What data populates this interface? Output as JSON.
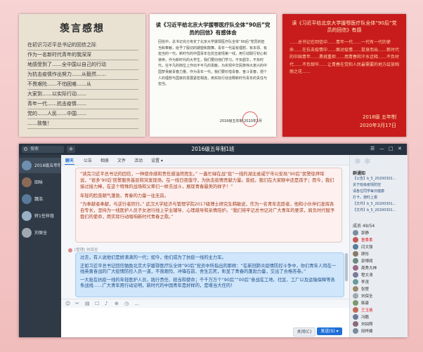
{
  "photos": {
    "p1_title": "羡言感想",
    "p1_lines": [
      "在初识习近平总书记的回信之际",
      "作为一名新时代青年的我深深",
      "地感受到了……全中国以自己的行动",
      "为抗击疫情作出努力……从毅然……",
      "不畏艰险……不怕困难……从",
      "大家到……以实际行动……",
      "青年一代……抗击疫情……",
      "党的……人民……中国……",
      "……致敬！"
    ],
    "p2_title": "读《习近平给北京大学援鄂医疗队全体“90后”党员的回信》有感体会",
    "p2_body": "回信中，总书记充分肯定了北京大学援鄂医疗队全体“90后”党员的担当和奉献，给予了殷切的期望和鼓舞。青年一代是有理想、有本领、有担当的一代，新时代的中国青年在抗击疫情第一线，用行动践行初心和使命。作为新时代的大学生，我们要向他们学习，不负韶华，不负时代，在平凡的岗位上作出不平凡的贡献，为实现中华民族伟大复兴的中国梦贡献青春力量。作为青年一代，我们要珍惜青春、奋斗青春，把个人的理想与国家的发展紧密相连，用实际行动诠释新时代青年的责任与担当。",
    "p2_sign": "2016级五年制 2020年3月",
    "p3_title": "读《习近平给北京大学援鄂医疗队全体“90后”党员的回信》有感",
    "p3_body": "……总书记在回信中……青年一代……一代有一代的使命……在抗击疫情中……面对疫情……挺身而出……新时代的中国青年……勇挑重担……用青春和汗水诠释……不负时代……不负韶华……让青春在党和人民最需要的地方绽放绚丽之花……",
    "p3_sign": "2018级 五年制\n2020年3月17日"
  },
  "window": {
    "search_placeholder": "搜索",
    "plus_label": "+",
    "title": "2016级五年制1班",
    "controls": [
      "☰",
      "—",
      "□",
      "✕"
    ]
  },
  "conversations": [
    {
      "name": "2016级五年制1",
      "color": "#6f8fb0"
    },
    {
      "name": "田咏",
      "color": "#8a6b5a"
    },
    {
      "name": "魏浩",
      "color": "#5a7a9a"
    },
    {
      "name": "转1任梓煊",
      "color": "#9ab0c4"
    },
    {
      "name": "刘保全",
      "color": "#a0a8b0"
    }
  ],
  "tabs": [
    "聊天",
    "公告",
    "相册",
    "文件",
    "活动",
    "设置 ▾"
  ],
  "message1": {
    "p1": "“读完习近平总书记的回信，一种使命感和责任感油然而生。” 一鑫忙碌在战“疫”一线的湖北省咸宁市公安局“90后”民警徐烨珲说，“很多‘90后’民警服务基层和突发现场，在一线日夜值守，为抗击疫情贡献力量。曾经，我们在大家眼中还是孩子；而今，我们接过接力棒，在这个特殊的战场和父辈们一样去战斗，展现青春最美的样子！”",
    "p2": "年轻的脸庞朝气蓬勃，青春的力量一往无前。",
    "p3": "“为奉献者奉献，与逆行者同行。” 武汉大学经济与管理学院2017级博士研究生韩敏说，作为一名青年志愿者，他和小伙伴们发挥各自专长，坚持为一线医护人员子女进行线上学业辅导、心理疏导和亲情陪护。“我们将牢记总书记对广大青年的要求，肩负时代赋予我们的使命，用实际行动唱响新时代青春之歌。”"
  },
  "sender2": "[管理] 刘保全",
  "message2": {
    "p1": "过去，有人说他们是娇滴滴的一代；如今，他们成为了抗疫一线的主力军。",
    "p2": "正如习近平总书记回信勉励北京大学援鄂医疗队全体“90后”党员中所指出的那样：“在新冠肺炎疫情防控斗争中，你们青年人同在一线英勇奋战的广大疫情防控人员一道，不畏艰险、冲锋在前、舍生忘死，彰显了青春的蓬勃力量，交出了合格答卷。”",
    "p3": "一大批在抗疫一线的年轻医护人员，践行责任、担当和使命；千千万万个“90后”“00后”奋战在工地、社区、工厂以及运输保障等各条战线……广大青年用行动证明，新时代的中国青年是好样的，是堪当大任的！"
  },
  "toolbar_icons": [
    "☺",
    "✂",
    "▤",
    "☐",
    "♪",
    "⊕",
    "◷",
    "…"
  ],
  "buttons": {
    "close": "关闭(C)",
    "send": "发送(S) ▾"
  },
  "notice": {
    "title": "群通知",
    "items": [
      "【公告】b_5_20200301...",
      "关于班级疫情防控",
      "请各位同学每日健康",
      "打卡，按时上报",
      "【文件】b_5_20200301...",
      "【文件】b_5_20200301..."
    ]
  },
  "members": {
    "header": "成员 49/54",
    "list": [
      {
        "name": "郭静",
        "red": false,
        "color": "#7a8da0"
      },
      {
        "name": "童柔柔",
        "red": true,
        "color": "#c05a5a"
      },
      {
        "name": "闫文强",
        "red": false,
        "color": "#5a7a9a"
      },
      {
        "name": "顾彤",
        "red": false,
        "color": "#8a7a6a"
      },
      {
        "name": "郭博闻",
        "red": false,
        "color": "#6a8a7a"
      },
      {
        "name": "周秀大神",
        "red": false,
        "color": "#9a6a8a"
      },
      {
        "name": "程文涛",
        "red": false,
        "color": "#7a7a9a"
      },
      {
        "name": "李茂",
        "red": false,
        "color": "#6a9a9a"
      },
      {
        "name": "张楚",
        "red": false,
        "color": "#9a8a6a"
      },
      {
        "name": "刘保全",
        "red": false,
        "color": "#a0a8b0"
      },
      {
        "name": "韩康",
        "red": false,
        "color": "#7a9a6a"
      },
      {
        "name": "王玉格",
        "red": true,
        "color": "#c06a5a"
      },
      {
        "name": "冯鹏",
        "red": false,
        "color": "#6a7a9a"
      },
      {
        "name": "刘拍照",
        "red": false,
        "color": "#8a6a7a"
      },
      {
        "name": "段梓健",
        "red": false,
        "color": "#7a8a9a"
      }
    ]
  }
}
